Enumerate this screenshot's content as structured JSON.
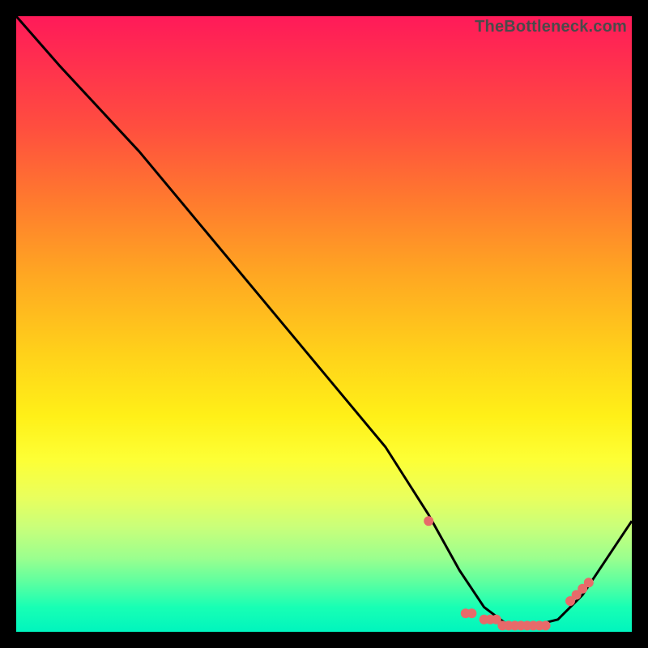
{
  "watermark": "TheBottleneck.com",
  "chart_data": {
    "type": "line",
    "title": "",
    "xlabel": "",
    "ylabel": "",
    "xlim": [
      0,
      100
    ],
    "ylim": [
      0,
      100
    ],
    "grid": false,
    "series": [
      {
        "name": "curve",
        "color": "#000000",
        "x": [
          0,
          7,
          20,
          30,
          40,
          50,
          60,
          67,
          72,
          76,
          80,
          84,
          88,
          92,
          100
        ],
        "y": [
          100,
          92,
          78,
          66,
          54,
          42,
          30,
          19,
          10,
          4,
          1,
          1,
          2,
          6,
          18
        ]
      }
    ],
    "markers": {
      "name": "dots",
      "color": "#e76a6a",
      "radius_px": 6,
      "x": [
        67,
        73,
        74,
        76,
        77,
        78,
        79,
        80,
        81,
        82,
        83,
        84,
        85,
        86,
        90,
        91,
        92,
        93
      ],
      "y": [
        18,
        3,
        3,
        2,
        2,
        2,
        1,
        1,
        1,
        1,
        1,
        1,
        1,
        1,
        5,
        6,
        7,
        8
      ]
    }
  }
}
